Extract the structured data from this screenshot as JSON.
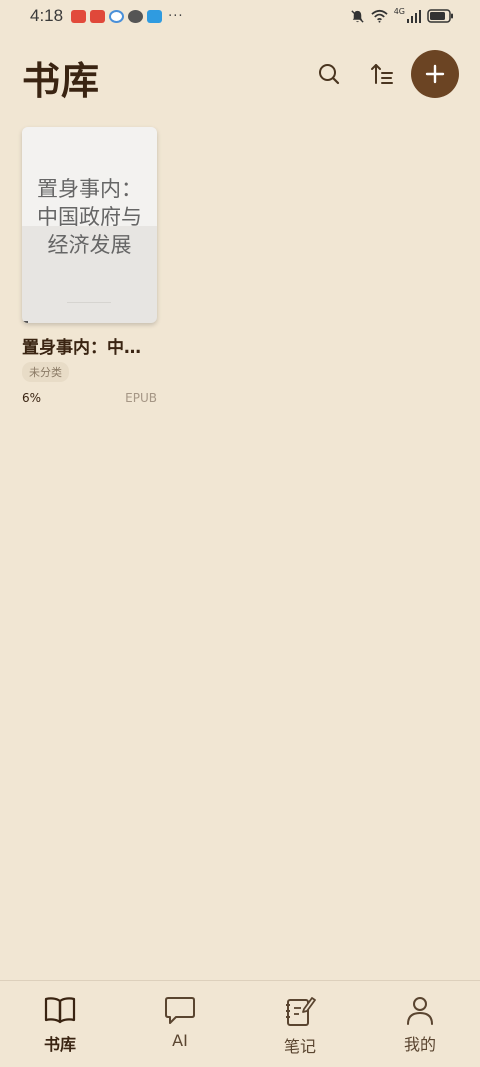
{
  "status_bar": {
    "time": "4:18",
    "notification_icons": [
      {
        "name": "huawei-app-icon",
        "color": "#e24a3b"
      },
      {
        "name": "review-app-icon",
        "color": "#e0483a"
      },
      {
        "name": "browser-app-icon",
        "color": "#4a90d9"
      },
      {
        "name": "wechat-icon",
        "color": "#555555"
      },
      {
        "name": "search-app-icon",
        "color": "#2f9be0"
      }
    ],
    "more": "···",
    "network": "4G"
  },
  "header": {
    "title": "书库"
  },
  "books": [
    {
      "cover_title": "置身事内：中国政府与经济发展",
      "title": "置身事内：中国政府与经济发展",
      "category": "未分类",
      "progress": "6%",
      "format": "EPUB"
    }
  ],
  "bottom_nav": {
    "items": [
      {
        "label": "书库",
        "icon": "book-icon",
        "active": true
      },
      {
        "label": "AI",
        "icon": "chat-bubble-icon",
        "active": false
      },
      {
        "label": "笔记",
        "icon": "notebook-icon",
        "active": false
      },
      {
        "label": "我的",
        "icon": "person-icon",
        "active": false
      }
    ]
  },
  "colors": {
    "background": "#f1e6d3",
    "accent": "#6b4423",
    "title_text": "#3a2412"
  }
}
